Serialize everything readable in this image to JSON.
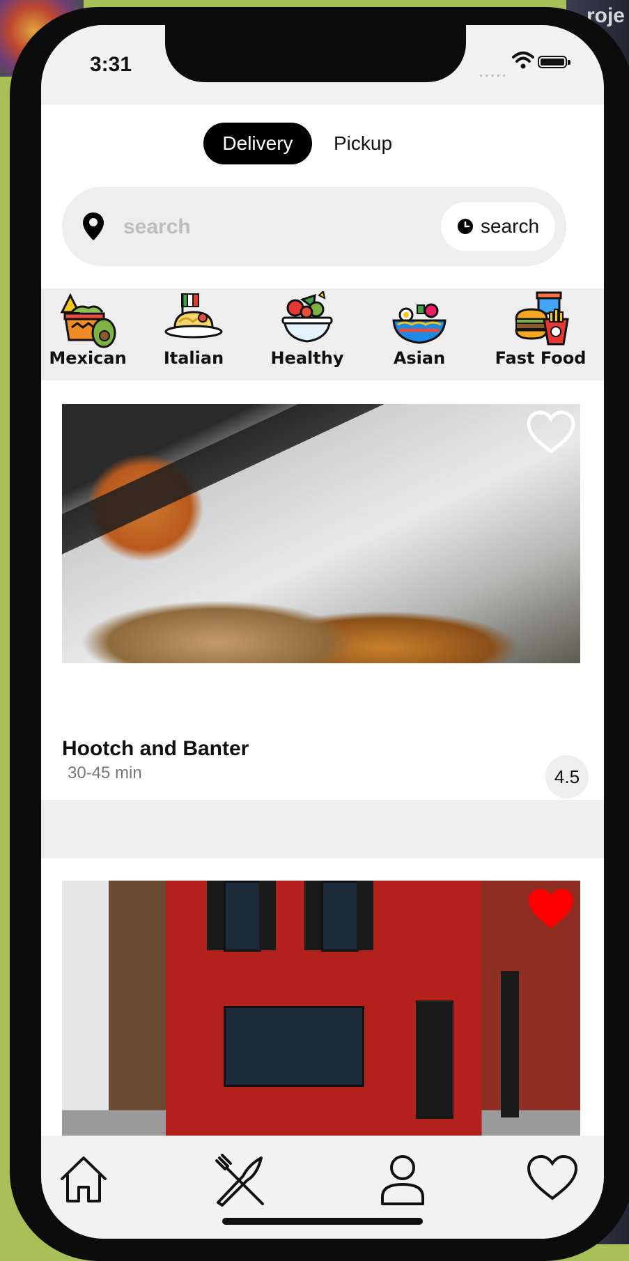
{
  "background_label": "roje",
  "status_bar": {
    "time": "3:31",
    "signal": "....."
  },
  "mode_toggle": {
    "delivery_label": "Delivery",
    "pickup_label": "Pickup"
  },
  "search": {
    "placeholder": "search",
    "button_label": "search"
  },
  "categories": [
    {
      "label": "Mexican"
    },
    {
      "label": "Italian"
    },
    {
      "label": "Healthy"
    },
    {
      "label": "Asian"
    },
    {
      "label": "Fast Food"
    }
  ],
  "restaurants": [
    {
      "name": "Hootch and Banter",
      "time": "30-45 min",
      "rating": "4.5",
      "favorited": false
    },
    {
      "favorited": true
    }
  ],
  "colors": {
    "favorite": "#ff0000",
    "toggle_active": "#000000",
    "surface": "#eeeeee"
  },
  "tab_bar": {
    "icons": [
      "home-icon",
      "utensils-icon",
      "user-icon",
      "heart-icon"
    ]
  }
}
